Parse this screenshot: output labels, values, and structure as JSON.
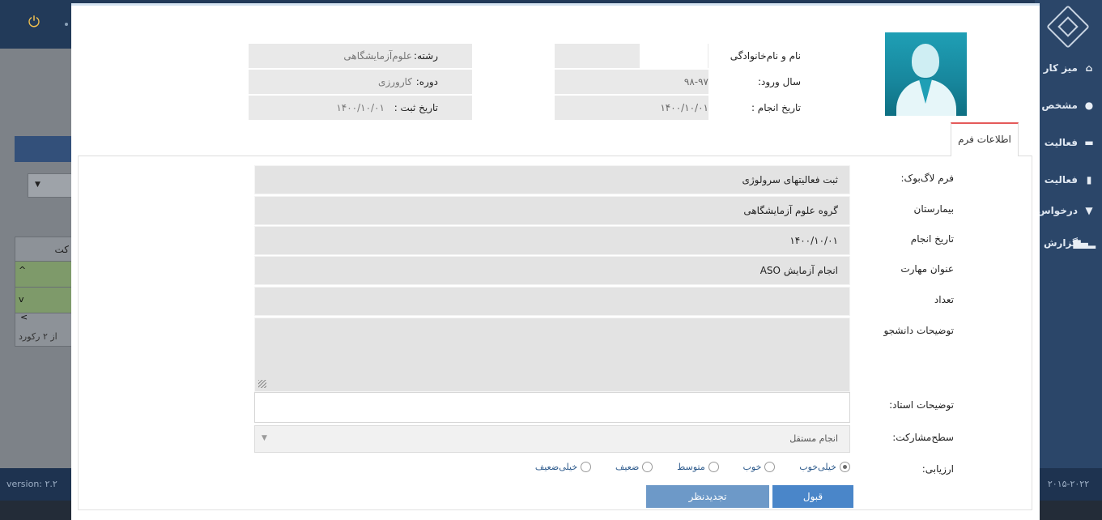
{
  "background_app": {
    "nav_items": [
      {
        "label": "میز کار",
        "icon": "home-icon"
      },
      {
        "label": "مشخص",
        "icon": "user-icon"
      },
      {
        "label": "فعالیت",
        "icon": "briefcase-icon"
      },
      {
        "label": "فعالیت",
        "icon": "book-icon"
      },
      {
        "label": "درخواس",
        "icon": "bookmark-icon"
      },
      {
        "label": "گزارش",
        "icon": "bar-chart-icon"
      }
    ],
    "version_text": "version: ۲.۲",
    "copyright_text": "۲۰۱۵-۲۰۲۲",
    "table_header": "کت",
    "records_text": "از ۲ رکورد"
  },
  "header": {
    "name_label": "نام و نام‌خانوادگی",
    "name_value": "",
    "major_label": "رشته:",
    "major_value": "علوم‌آزمایشگاهی",
    "entry_year_label": "سال ورود:",
    "entry_year_value": "۹۸-۹۷",
    "course_label": "دوره:",
    "course_value": "کارورزی",
    "done_date_label": "تاریخ انجام :",
    "done_date_value": "۱۴۰۰/۱۰/۰۱",
    "register_date_label": "تاریخ ثبت :",
    "register_date_value": "۱۴۰۰/۱۰/۰۱"
  },
  "tab": {
    "label": "اطلاعات فرم"
  },
  "form": {
    "logbook_label": "فرم لاگ‌بوک:",
    "logbook_value": "ثبت فعالیتهای سرولوژی",
    "hospital_label": "بیمارستان",
    "hospital_value": "گروه علوم آزمایشگاهی",
    "date_label": "تاریخ انجام",
    "date_value": "۱۴۰۰/۱۰/۰۱",
    "skill_label": "عنوان مهارت",
    "skill_value": "انجام آزمایش ASO",
    "count_label": "تعداد",
    "count_value": "",
    "student_notes_label": "توضیحات دانشجو",
    "student_notes_value": "",
    "teacher_notes_label": "توضیحات استاد:",
    "teacher_notes_value": "",
    "participation_label": "سطح‌مشارکت:",
    "participation_value": "انجام مستقل",
    "rating_label": "ارزیابی:",
    "rating_options": [
      "خیلی‌خوب",
      "خوب",
      "متوسط",
      "ضعیف",
      "خیلی‌ضعیف"
    ],
    "rating_selected": "خیلی‌خوب"
  },
  "buttons": {
    "accept": "قبول",
    "review": "تجدیدنظر"
  },
  "colors": {
    "primary_button": "#4a86c9",
    "secondary_button": "#6d99c8",
    "tab_accent": "#e45a5a",
    "nav_background": "#2b4669"
  }
}
